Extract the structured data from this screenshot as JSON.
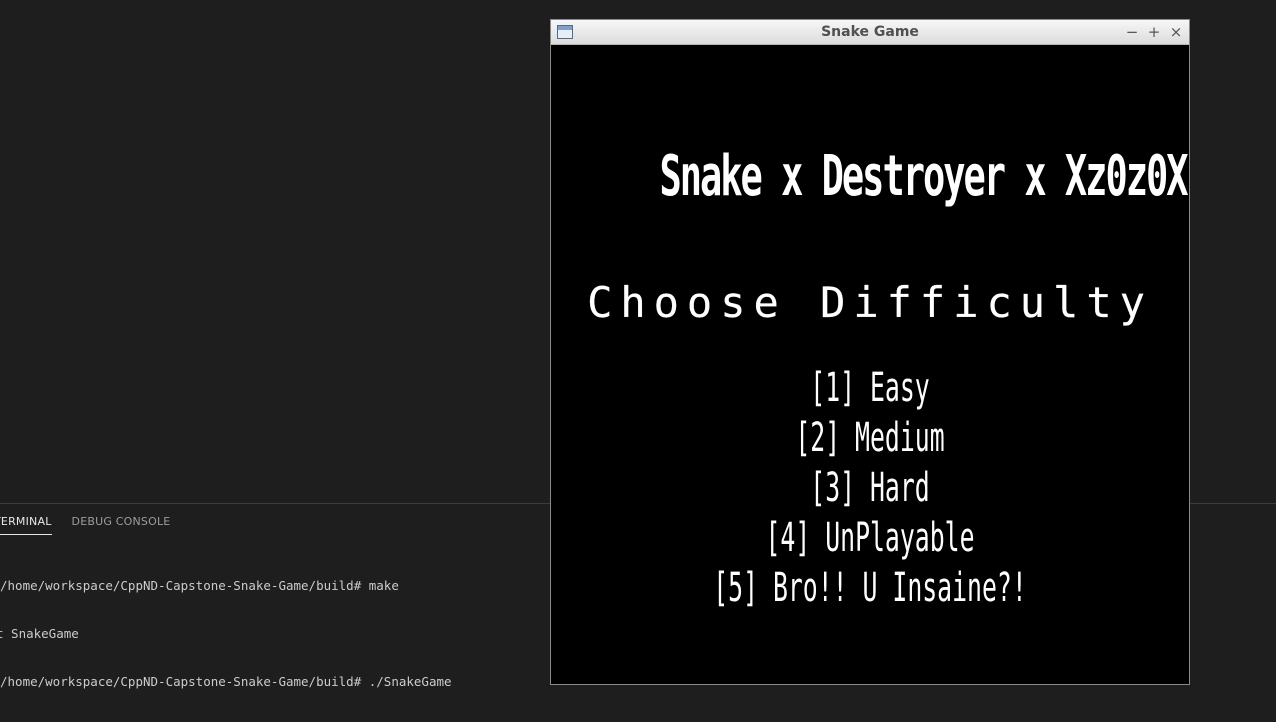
{
  "terminal": {
    "tabs": [
      {
        "label": "TERMINAL",
        "active": true
      },
      {
        "label": "DEBUG CONSOLE",
        "active": false
      }
    ],
    "lines": [
      "/home/workspace/CppND-Capstone-Snake-Game/build# make",
      "t SnakeGame",
      "/home/workspace/CppND-Capstone-Snake-Game/build# ./SnakeGame"
    ]
  },
  "window": {
    "title": "Snake Game",
    "controls": {
      "minimize": "−",
      "maximize": "+",
      "close": "×"
    }
  },
  "game": {
    "title": "Snake x Destroyer x Xz0z0X",
    "heading": "Choose Difficulty",
    "options": [
      "[1] Easy",
      "[2] Medium",
      "[3] Hard",
      "[4] UnPlayable",
      "[5] Bro!! U Insaine?!"
    ]
  },
  "colors": {
    "background": "#1e1e1e",
    "game_background": "#000000",
    "game_text": "#ffffff"
  }
}
